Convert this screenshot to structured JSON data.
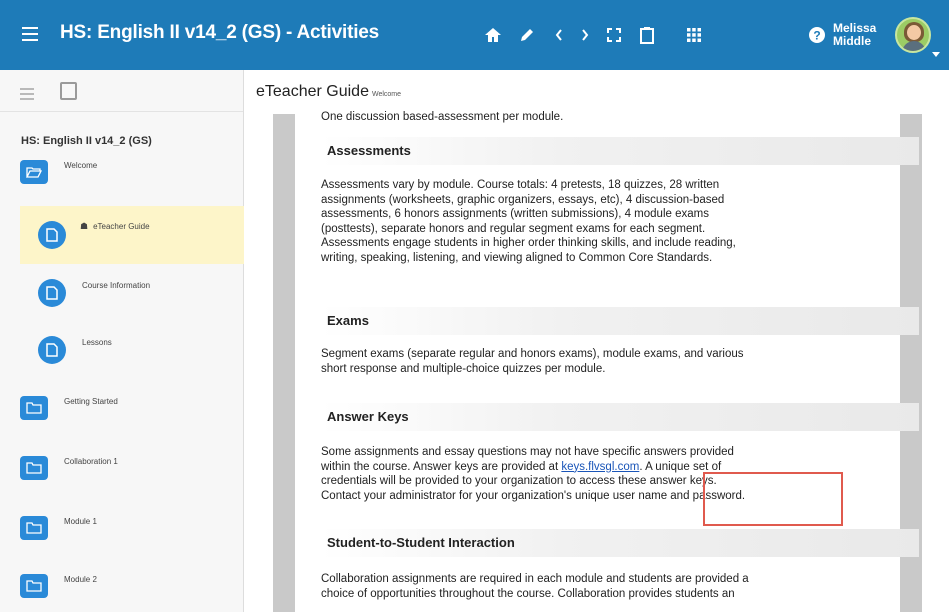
{
  "header": {
    "title": "HS: English II v14_2 (GS) - Activities",
    "user_first": "Melissa",
    "user_last": "Middle",
    "icons": [
      "menu-icon",
      "home-icon",
      "pencil-icon",
      "chevron-left-icon",
      "chevron-right-icon",
      "fullscreen-icon",
      "clipboard-icon",
      "apps-grid-icon",
      "help-icon"
    ]
  },
  "sidebar": {
    "course": "HS: English II v14_2 (GS)",
    "items": [
      {
        "label": "Welcome",
        "type": "folder-open"
      },
      {
        "label": "eTeacher Guide",
        "type": "page",
        "active": true
      },
      {
        "label": "Course Information",
        "type": "page"
      },
      {
        "label": "Lessons",
        "type": "page"
      },
      {
        "label": "Getting Started",
        "type": "folder"
      },
      {
        "label": "Collaboration 1",
        "type": "folder"
      },
      {
        "label": "Module 1",
        "type": "folder"
      },
      {
        "label": "Module 2",
        "type": "folder"
      }
    ]
  },
  "main": {
    "title": "eTeacher Guide",
    "breadcrumb": "Welcome",
    "intro_line": "One discussion based-assessment per module.",
    "sections": [
      {
        "heading": "Assessments",
        "lines": [
          "Assessments vary by module. Course totals: 4 pretests, 18 quizzes, 28 written",
          "assignments (worksheets, graphic organizers, essays, etc), 4 discussion-based",
          "assessments, 6 honors assignments (written submissions), 4 module exams",
          "(posttests), separate honors and regular segment exams for each segment.",
          "Assessments engage students in higher order thinking skills, and include reading,",
          "writing, speaking, listening, and viewing aligned to Common Core Standards."
        ]
      },
      {
        "heading": "Exams",
        "lines": [
          "Segment exams (separate regular and honors exams), module exams, and various",
          "short response and multiple-choice quizzes per module."
        ]
      },
      {
        "heading": "Answer Keys",
        "line1": "Some assignments and essay questions may not have specific answers provided",
        "line2_pre": "within the course. Answer keys are provided at ",
        "line2_link": "keys.flvsgl.com",
        "line2_post": ". A unique set of",
        "line3": "credentials will be provided to your organization to access these answer keys.",
        "line4": "Contact your administrator for your organization's unique user name and password."
      },
      {
        "heading": "Student-to-Student Interaction",
        "lines": [
          "Collaboration assignments are required in each module and students are provided a",
          "choice of opportunities throughout the course. Collaboration provides students an"
        ]
      }
    ]
  },
  "colors": {
    "header_bg": "#1e7bb8",
    "accent_blue": "#2a8ad8",
    "active_row": "#fdf5c9",
    "highlight_box": "#e05a4e",
    "link": "#1a55b8"
  }
}
